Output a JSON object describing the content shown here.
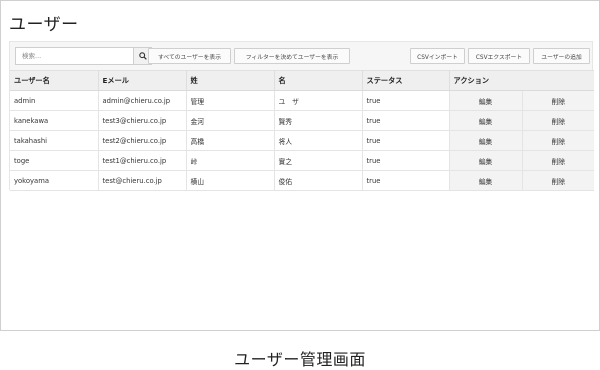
{
  "page": {
    "title": "ユーザー"
  },
  "toolbar": {
    "search_placeholder": "検索...",
    "show_all_users": "すべてのユーザーを表示",
    "show_filtered_users": "フィルターを決めてユーザーを表示",
    "csv_import": "CSVインポート",
    "csv_export": "CSVエクスポート",
    "add_user": "ユーザーの追加"
  },
  "table": {
    "headers": [
      "ユーザー名",
      "Eメール",
      "姓",
      "名",
      "ステータス",
      "アクション"
    ],
    "edit_label": "編集",
    "delete_label": "削除",
    "rows": [
      {
        "username": "admin",
        "email": "admin@chieru.co.jp",
        "last_name": "管理",
        "first_name": "ユ　ザ",
        "status": "true"
      },
      {
        "username": "kanekawa",
        "email": "test3@chieru.co.jp",
        "last_name": "金河",
        "first_name": "賢秀",
        "status": "true"
      },
      {
        "username": "takahashi",
        "email": "test2@chieru.co.jp",
        "last_name": "高橋",
        "first_name": "将人",
        "status": "true"
      },
      {
        "username": "toge",
        "email": "test1@chieru.co.jp",
        "last_name": "峠",
        "first_name": "實之",
        "status": "true"
      },
      {
        "username": "yokoyama",
        "email": "test@chieru.co.jp",
        "last_name": "横山",
        "first_name": "俊佑",
        "status": "true"
      }
    ]
  },
  "caption": "ユーザー管理画面"
}
